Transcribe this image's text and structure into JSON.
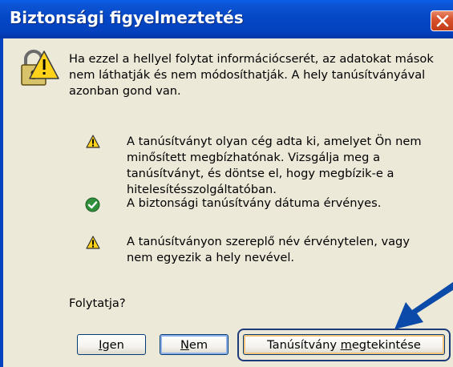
{
  "window": {
    "title": "Biztonsági figyelmeztetés"
  },
  "content": {
    "intro": "Ha ezzel a hellyel folytat információcserét, az adatokat mások nem láthatják és nem módosíthatják. A hely tanúsítványával azonban gond van.",
    "warnings": [
      {
        "icon": "warning-icon",
        "text": "A tanúsítványt olyan cég adta ki, amelyet Ön nem minősített megbízhatónak. Vizsgálja meg a tanúsítványt, és döntse el, hogy megbízik-e a hitelesítésszolgáltatóban."
      },
      {
        "icon": "check-icon",
        "text": "A biztonsági tanúsítvány dátuma érvényes."
      },
      {
        "icon": "warning-icon",
        "text": "A tanúsítványon szereplő név érvénytelen, vagy nem egyezik a hely nevével."
      }
    ],
    "prompt": "Folytatja?"
  },
  "buttons": {
    "yes": {
      "mnemonic": "I",
      "rest": "gen"
    },
    "no": {
      "mnemonic": "N",
      "rest": "em"
    },
    "view": {
      "before": "Tanúsítvány ",
      "mnemonic": "m",
      "after": "egtekintése"
    }
  },
  "colors": {
    "titlebar": "#0442c0",
    "dialog_bg": "#ece9d8",
    "arrow": "#0b4aa8"
  }
}
